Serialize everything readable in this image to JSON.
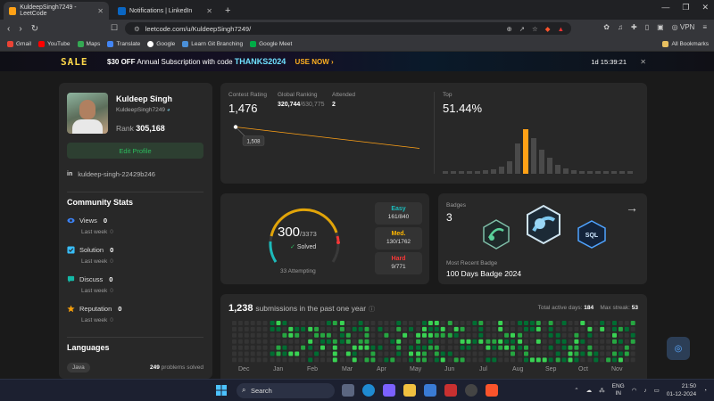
{
  "browser": {
    "tabs": [
      {
        "title": "KuldeepSingh7249 - LeetCode",
        "active": true
      },
      {
        "title": "Notifications | LinkedIn",
        "active": false
      }
    ],
    "new_tab": "+",
    "url": "leetcode.com/u/KuldeepSingh7249/",
    "vpn_label": "VPN",
    "bookmarks": [
      "Gmail",
      "YouTube",
      "Maps",
      "Translate",
      "Google",
      "Learn Git Branching",
      "Google Meet"
    ],
    "all_bookmarks": "All Bookmarks"
  },
  "banner": {
    "word": "SALE",
    "offer": "$30 OFF",
    "text": "Annual Subscription with code",
    "code": "THANKS2024",
    "cta": "USE NOW ›",
    "timer": "1d 15:39:21"
  },
  "profile": {
    "name": "Kuldeep Singh",
    "username": "KuldeepSingh7249",
    "rank_label": "Rank",
    "rank_value": "305,168",
    "edit_label": "Edit Profile",
    "linkedin": "kuldeep-singh-22429b246"
  },
  "community": {
    "title": "Community Stats",
    "stats": [
      {
        "label": "Views",
        "value": "0",
        "last_week_label": "Last week",
        "last_week": "0"
      },
      {
        "label": "Solution",
        "value": "0",
        "last_week_label": "Last week",
        "last_week": "0"
      },
      {
        "label": "Discuss",
        "value": "0",
        "last_week_label": "Last week",
        "last_week": "0"
      },
      {
        "label": "Reputation",
        "value": "0",
        "last_week_label": "Last week",
        "last_week": "0"
      }
    ]
  },
  "languages": {
    "title": "Languages",
    "items": [
      {
        "name": "Java",
        "count": "249",
        "suffix": "problems solved"
      }
    ]
  },
  "rating": {
    "contest_label": "Contest Rating",
    "contest_value": "1,476",
    "global_label": "Global Ranking",
    "global_value": "320,744",
    "global_total": "/630,775",
    "attended_label": "Attended",
    "attended_value": "2",
    "tooltip": "1,508",
    "top_label": "Top",
    "top_value": "51.44%"
  },
  "chart_data": {
    "type": "line",
    "title": "Contest Rating",
    "x": [
      1,
      2
    ],
    "values": [
      1508,
      1476
    ],
    "highlight_label": "1,508"
  },
  "solved": {
    "count": "300",
    "total": "/3373",
    "label": "Solved",
    "attempting": "33 Attempting",
    "difficulties": [
      {
        "name": "Easy",
        "value": "161/840",
        "color": "#1cbaba"
      },
      {
        "name": "Med.",
        "value": "130/1762",
        "color": "#ffb700"
      },
      {
        "name": "Hard",
        "value": "9/771",
        "color": "#f63737"
      }
    ]
  },
  "badges": {
    "label": "Badges",
    "count": "3",
    "recent_label": "Most Recent Badge",
    "recent_name": "100 Days Badge 2024"
  },
  "submissions": {
    "count": "1,238",
    "rest": "submissions in the past one year",
    "active_label": "Total active days:",
    "active_value": "184",
    "streak_label": "Max streak:",
    "streak_value": "53",
    "months": [
      "Dec",
      "Jan",
      "Feb",
      "Mar",
      "Apr",
      "May",
      "Jun",
      "Jul",
      "Aug",
      "Sep",
      "Oct",
      "Nov"
    ]
  },
  "taskbar": {
    "search": "Search",
    "lang_top": "ENG",
    "lang_bottom": "IN",
    "time": "21:50",
    "date": "01-12-2024"
  }
}
